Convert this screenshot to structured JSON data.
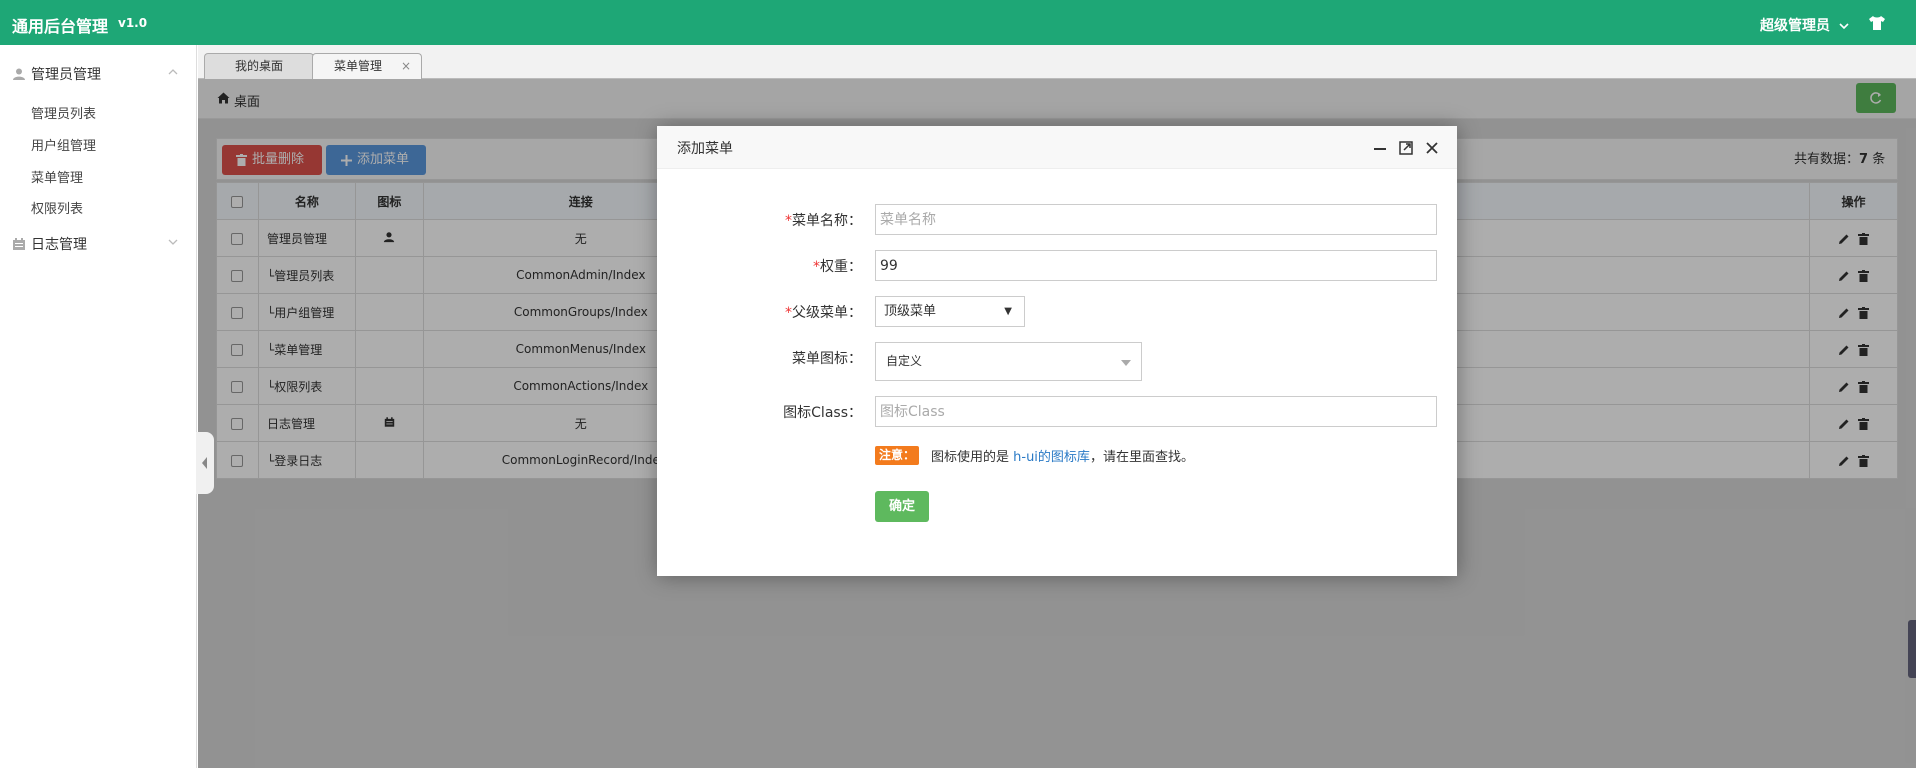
{
  "header": {
    "brand": "通用后台管理",
    "version": "v1.0",
    "user": "超级管理员"
  },
  "sidebar": {
    "groups": [
      {
        "label": "管理员管理",
        "items": [
          "管理员列表",
          "用户组管理",
          "菜单管理",
          "权限列表"
        ]
      },
      {
        "label": "日志管理"
      }
    ]
  },
  "tabs": [
    {
      "label": "我的桌面"
    },
    {
      "label": "菜单管理",
      "close": "×"
    }
  ],
  "breadcrumb": {
    "label": "桌面"
  },
  "toolbar": {
    "batch_delete": "批量删除",
    "add_menu": "添加菜单",
    "count_prefix": "共有数据：",
    "count_value": "7",
    "count_suffix": " 条"
  },
  "table": {
    "headers": [
      "名称",
      "图标",
      "连接",
      "操作"
    ],
    "rows": [
      {
        "name": "管理员管理",
        "icon": "user-icon",
        "link": "无"
      },
      {
        "name": "└管理员列表",
        "icon": "",
        "link": "CommonAdmin/Index"
      },
      {
        "name": "└用户组管理",
        "icon": "",
        "link": "CommonGroups/Index"
      },
      {
        "name": "└菜单管理",
        "icon": "",
        "link": "CommonMenus/Index"
      },
      {
        "name": "└权限列表",
        "icon": "",
        "link": "CommonActions/Index"
      },
      {
        "name": "日志管理",
        "icon": "calendar-icon",
        "link": "无"
      },
      {
        "name": "└登录日志",
        "icon": "",
        "link": "CommonLoginRecord/Inde"
      }
    ]
  },
  "modal": {
    "title": "添加菜单",
    "fields": {
      "menu_name_label": "菜单名称：",
      "menu_name_placeholder": "菜单名称",
      "weight_label": "权重：",
      "weight_value": "99",
      "parent_label": "父级菜单：",
      "parent_value": "顶级菜单",
      "icon_label": "菜单图标：",
      "icon_value": "自定义",
      "icon_class_label": "图标Class：",
      "icon_class_placeholder": "图标Class"
    },
    "note_badge": "注意：",
    "note_pre": "图标使用的是 ",
    "note_link": "h-ui的图标库",
    "note_post": "，请在里面查找。",
    "submit": "确定"
  },
  "colors": {
    "brand_green": "#1ea776",
    "danger": "#dd514c",
    "primary": "#5a98de",
    "success": "#5eb95e",
    "warning": "#f37b1d"
  }
}
